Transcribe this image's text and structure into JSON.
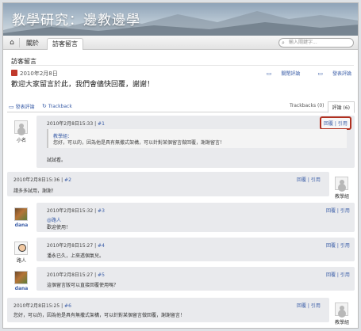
{
  "site": {
    "title": "教學研究：邊教邊學"
  },
  "nav": {
    "home_icon": "home-icon",
    "items": [
      "關於",
      "訪客留言"
    ],
    "search_placeholder": "輸入關鍵字..."
  },
  "page": {
    "heading": "訪客留言",
    "date": "2010年2月8日",
    "link_close_comments": "關閉評論",
    "link_post_comment": "發表評論",
    "intro": "歡迎大家留言於此，我們會儘快回覆，謝謝！"
  },
  "tabs": {
    "post_comment": "發表評論",
    "trackback": "Trackback",
    "trackbacks_count": "Trackbacks (0)",
    "comments_count": "評論 (6)"
  },
  "comments": [
    {
      "meta": "2010年2月8日15:33 |",
      "num": "#1",
      "author": "小名",
      "reply": "回覆",
      "quote": "引用",
      "quote_name": "教學組：",
      "quote_text": "您好，可以的，因為他是具有無撒式架構，可以針對某個留言做回覆，謝謝留言！",
      "body": "試試看。"
    },
    {
      "meta": "2010年2月8日15:36 |",
      "num": "#2",
      "author": "教學組",
      "reply": "回覆",
      "quote": "引用",
      "body": "請多多試用，謝謝！"
    },
    {
      "meta": "2010年2月8日15:32 |",
      "num": "#3",
      "author": "dana",
      "reply": "回覆",
      "quote": "引用",
      "mention": "@路人",
      "body": "歡迎使用！"
    },
    {
      "meta": "2010年2月8日15:27 |",
      "num": "#4",
      "author": "路人",
      "reply": "回覆",
      "quote": "引用",
      "body": "潘永已久，上來透個氣兒。"
    },
    {
      "meta": "2010年2月8日15:27 |",
      "num": "#5",
      "author": "dana",
      "reply": "回覆",
      "quote": "引用",
      "body": "這個留言版可以直接回覆使用嗎？"
    },
    {
      "meta": "2010年2月8日15:25 |",
      "num": "#6",
      "author": "教學組",
      "reply": "回覆",
      "quote": "引用",
      "body": "您好，可以的，因為他是具有無撒式架構，可以針對某個留言做回覆，謝謝留言！"
    }
  ],
  "colors": {
    "accent": "#3b5ea8",
    "highlight_outline": "#b03020",
    "comment_bg": "#e9eaed"
  }
}
